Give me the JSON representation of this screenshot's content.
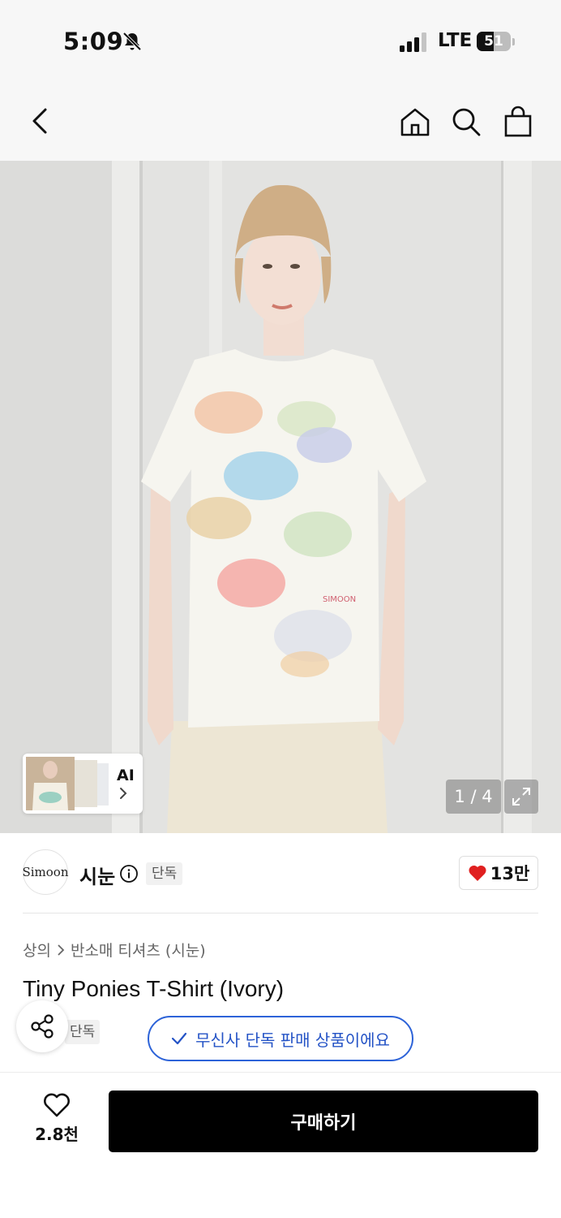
{
  "status_bar": {
    "time": "5:09",
    "network": "LTE",
    "battery": "51",
    "battery_level": 0.51
  },
  "nav": {
    "back_icon": "chevron-left-icon",
    "home_icon": "home-icon",
    "search_icon": "search-icon",
    "cart_icon": "shopping-bag-icon"
  },
  "product_image": {
    "ai_label": "AI",
    "page_indicator": "1 / 4",
    "shirt_print_text": "SIMOON"
  },
  "brand": {
    "logo_text": "Simoon",
    "name": "시눈",
    "exclusive_badge": "단독",
    "like_count": "13만"
  },
  "breadcrumb": {
    "category": "상의",
    "subcategory": "반소매 티셔츠 (시눈)"
  },
  "product": {
    "title": "Tiny Ponies T-Shirt (Ivory)",
    "exclusive_tag": "단독",
    "exclusive_notice": "무신사 단독 판매 상품이에요"
  },
  "bottom_bar": {
    "wish_count": "2.8천",
    "buy_label": "구매하기"
  },
  "colors": {
    "accent_blue": "#2d63d8",
    "heart_red": "#e02020",
    "buy_bg": "#000000"
  }
}
